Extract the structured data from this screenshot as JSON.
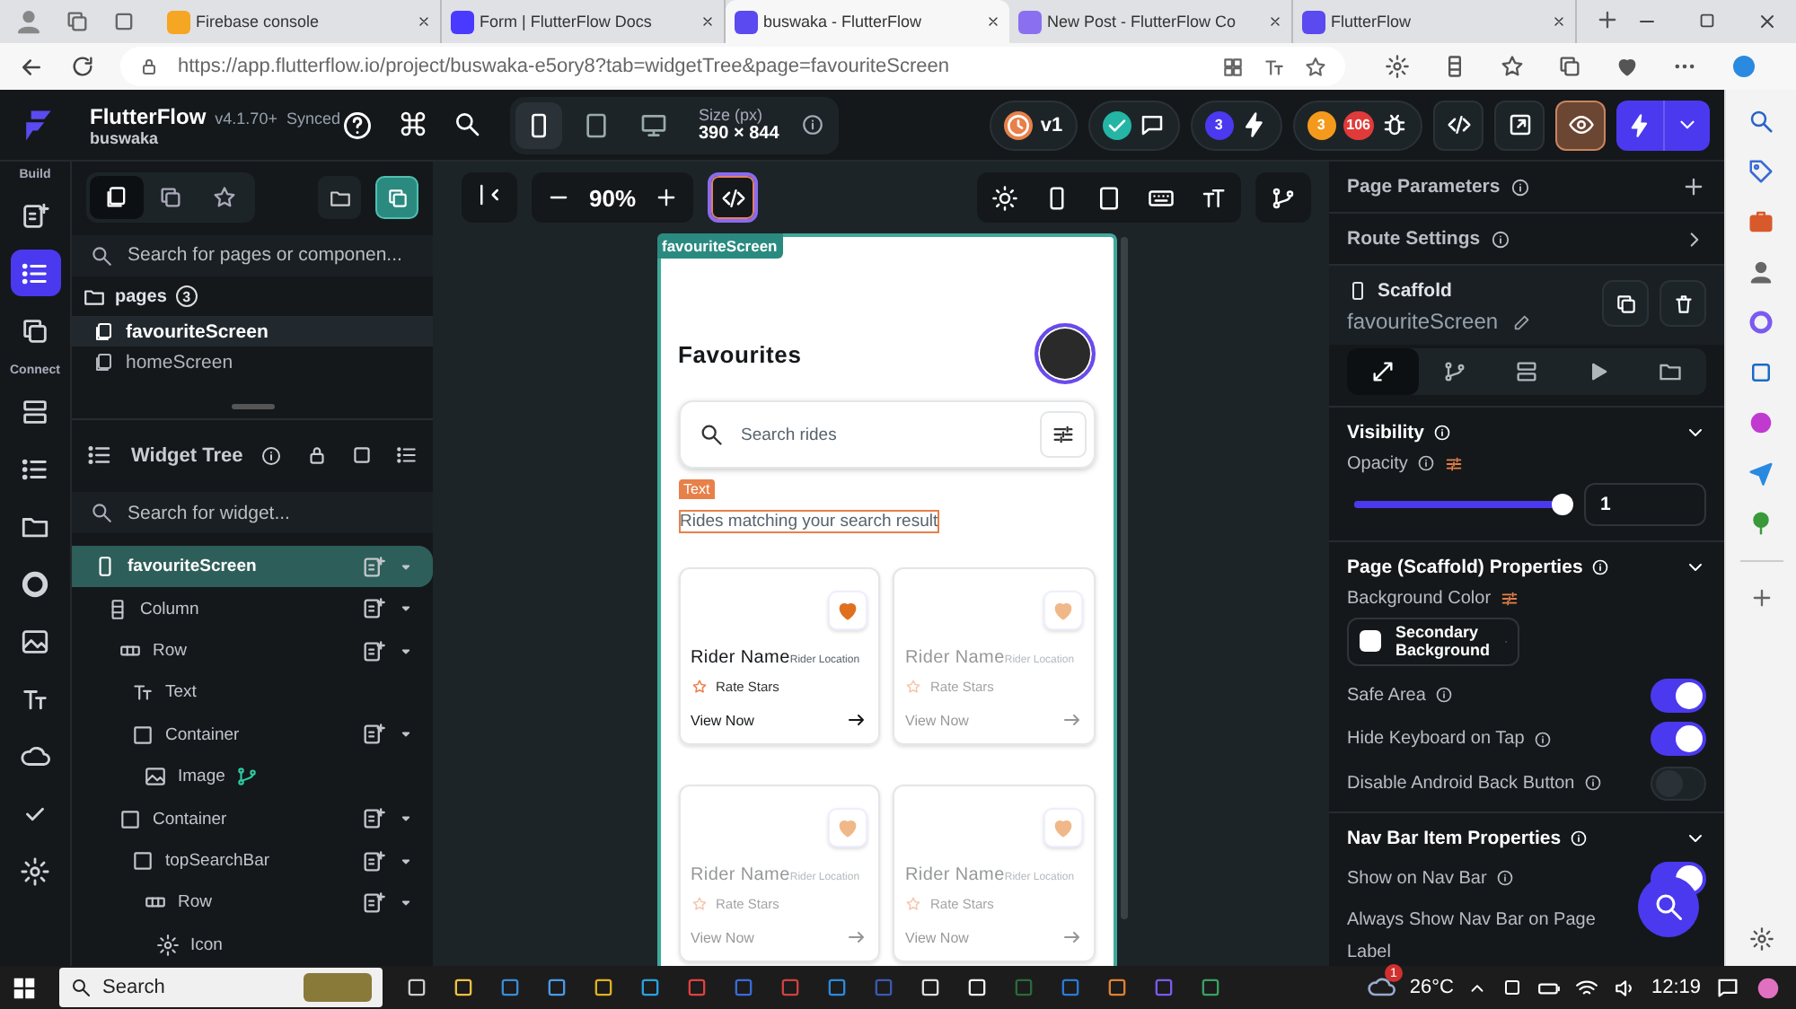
{
  "browser": {
    "tabs": [
      {
        "title": "Firebase console",
        "selected": false
      },
      {
        "title": "Form | FlutterFlow Docs",
        "selected": false
      },
      {
        "title": "buswaka - FlutterFlow",
        "selected": true
      },
      {
        "title": "New Post - FlutterFlow Co",
        "selected": false
      },
      {
        "title": "FlutterFlow",
        "selected": false
      }
    ],
    "url": "https://app.flutterflow.io/project/buswaka-e5ory8?tab=widgetTree&page=favouriteScreen"
  },
  "toolbar": {
    "app_name": "FlutterFlow",
    "version": "v4.1.70+",
    "sync_status": "Synced",
    "project": "buswaka",
    "devices": [
      {
        "kind": "phone",
        "selected": true
      },
      {
        "kind": "tablet",
        "selected": false
      },
      {
        "kind": "desktop",
        "selected": false
      }
    ],
    "size_label": "Size (px)",
    "size_value": "390 × 844",
    "version_badge": "v1",
    "agent_count": "3",
    "warning_count": "3",
    "error_count": "106",
    "preview_on": true
  },
  "rail": {
    "build_label": "Build",
    "connect_label": "Connect",
    "items": [
      {
        "selected": false
      },
      {
        "selected": true
      },
      {
        "selected": false
      },
      {
        "selected": false
      },
      {
        "selected": false
      },
      {
        "selected": false
      },
      {
        "selected": false
      },
      {
        "selected": false
      },
      {
        "selected": false
      },
      {
        "selected": false
      },
      {
        "selected": false
      },
      {
        "selected": false
      }
    ]
  },
  "left_panel": {
    "tabs": [
      {
        "selected": true
      },
      {
        "selected": false
      },
      {
        "selected": false
      }
    ],
    "page_search_placeholder": "Search for pages or componen...",
    "pages": {
      "label": "pages",
      "count": "3",
      "items": [
        {
          "name": "favouriteScreen",
          "selected": true
        },
        {
          "name": "homeScreen",
          "selected": false
        }
      ]
    },
    "widget_tree": {
      "title": "Widget Tree",
      "search_placeholder": "Search for widget...",
      "nodes": [
        {
          "kind": "page",
          "name": "favouriteScreen",
          "selected": true,
          "children": [
            {
              "kind": "column",
              "name": "Column",
              "selected": false,
              "children": [
                {
                  "kind": "row",
                  "name": "Row",
                  "selected": false,
                  "children": [
                    {
                      "kind": "text",
                      "name": "Text",
                      "selected": false
                    },
                    {
                      "kind": "container",
                      "name": "Container",
                      "selected": false,
                      "children": [
                        {
                          "kind": "image",
                          "name": "Image",
                          "selected": false
                        }
                      ]
                    }
                  ]
                },
                {
                  "kind": "container",
                  "name": "Container",
                  "selected": false,
                  "children": [
                    {
                      "kind": "container",
                      "name": "topSearchBar",
                      "selected": false,
                      "children": [
                        {
                          "kind": "row",
                          "name": "Row",
                          "selected": false,
                          "children": [
                            {
                              "kind": "icon",
                              "name": "Icon",
                              "selected": false
                            }
                          ]
                        }
                      ]
                    }
                  ]
                }
              ]
            }
          ]
        }
      ]
    }
  },
  "canvas": {
    "zoom": "90%",
    "page_label": "favouriteScreen",
    "screen": {
      "title": "Favourites",
      "search_placeholder": "Search rides",
      "selection_tag": "Text",
      "subtitle": "Rides matching your search result",
      "cards": [
        {
          "name": "Rider Name",
          "location": "Rider Location",
          "rating": "Rate Stars",
          "action": "View Now",
          "dimmed": false
        },
        {
          "name": "Rider Name",
          "location": "Rider Location",
          "rating": "Rate Stars",
          "action": "View Now",
          "dimmed": true
        },
        {
          "name": "Rider Name",
          "location": "Rider Location",
          "rating": "Rate Stars",
          "action": "View Now",
          "dimmed": true
        },
        {
          "name": "Rider Name",
          "location": "Rider Location",
          "rating": "Rate Stars",
          "action": "View Now",
          "dimmed": true
        }
      ]
    }
  },
  "properties": {
    "page_parameters": "Page Parameters",
    "route_settings": "Route Settings",
    "widget_type": "Scaffold",
    "widget_name": "favouriteScreen",
    "tabs": [
      {
        "selected": true
      },
      {
        "selected": false
      },
      {
        "selected": false
      },
      {
        "selected": false
      },
      {
        "selected": false
      }
    ],
    "visibility": {
      "title": "Visibility",
      "opacity_label": "Opacity",
      "level": 0.97,
      "opacity_value": "1"
    },
    "page_props": {
      "title": "Page (Scaffold) Properties",
      "bg_label": "Background Color",
      "bg_value": "Secondary Background",
      "toggles": [
        {
          "label": "Safe Area",
          "on": true
        },
        {
          "label": "Hide Keyboard on Tap",
          "on": true
        },
        {
          "label": "Disable Android Back Button",
          "on": false
        }
      ]
    },
    "nav_bar": {
      "title": "Nav Bar Item Properties",
      "toggles": [
        {
          "label": "Show on Nav Bar",
          "on": true
        }
      ],
      "always_show_label": "Always Show Nav Bar on Page",
      "label_label": "Label"
    }
  },
  "taskbar": {
    "search_label": "Search",
    "weather_badge": "1",
    "temperature": "26°C",
    "time": "12:19"
  }
}
